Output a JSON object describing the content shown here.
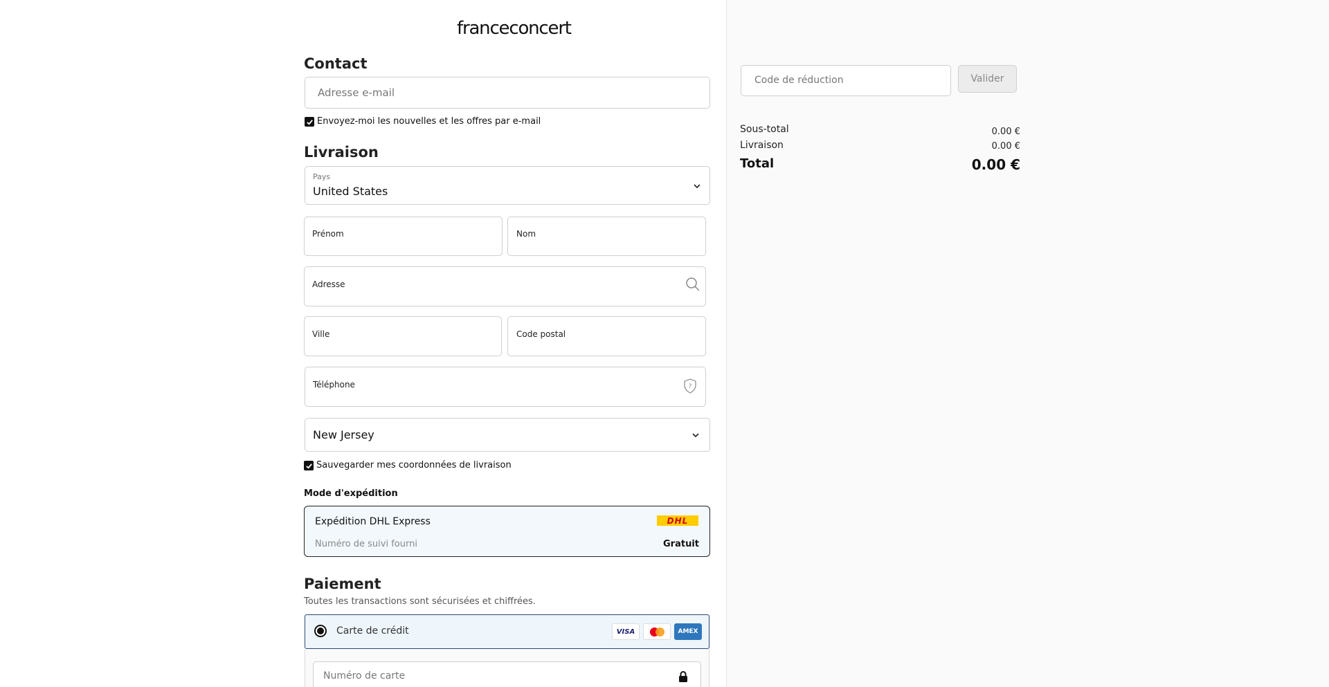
{
  "brand": {
    "logo_text": "franceconcert"
  },
  "contact": {
    "title": "Contact",
    "email_placeholder": "Adresse e-mail",
    "newsletter_label": "Envoyez-moi les nouvelles et les offres par e-mail",
    "newsletter_checked": true
  },
  "delivery": {
    "title": "Livraison",
    "country_label": "Pays",
    "country_value": "United States",
    "first_name_label": "Prénom",
    "last_name_label": "Nom",
    "address_label": "Adresse",
    "city_label": "Ville",
    "postal_label": "Code postal",
    "phone_label": "Téléphone",
    "state_value": "New Jersey",
    "save_label": "Sauvegarder mes coordonnées de livraison",
    "save_checked": true
  },
  "shipping": {
    "title": "Mode d'expédition",
    "method_name": "Expédition DHL Express",
    "method_sub": "Numéro de suivi fourni",
    "method_price": "Gratuit",
    "carrier_logo": "DHL"
  },
  "payment": {
    "title": "Paiement",
    "subtitle": "Toutes les transactions sont sécurisées et chiffrées.",
    "method_label": "Carte de crédit",
    "card_logos": [
      "VISA",
      "mastercard",
      "AMEX"
    ],
    "card_number_placeholder": "Numéro de carte"
  },
  "summary": {
    "discount_placeholder": "Code de réduction",
    "apply_label": "Valider",
    "subtotal_label": "Sous-total",
    "subtotal_value": "0.00 €",
    "shipping_label": "Livraison",
    "shipping_value": "0.00 €",
    "total_label": "Total",
    "total_value": "0.00 €"
  },
  "colors": {
    "accent_border": "#2b4a6f",
    "dhl_yellow": "#ffcc00",
    "dhl_red": "#d40511",
    "amex_blue": "#2e77bc"
  }
}
